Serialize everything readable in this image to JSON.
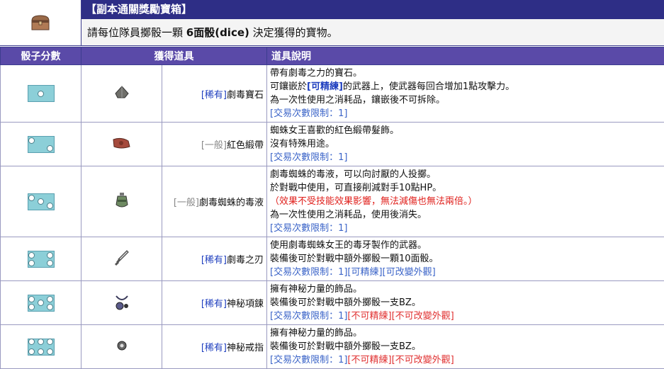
{
  "header": {
    "title": "【副本通關獎勵寶箱】",
    "desc_pre": "請每位隊員擲骰一顆 ",
    "desc_bold": "6面骰(dice)",
    "desc_post": " 決定獲得的寶物。",
    "icon": "treasure-chest-icon"
  },
  "columns": {
    "dice": "骰子分數",
    "item": "獲得道具",
    "desc": "道具說明"
  },
  "rows": [
    {
      "pips": 1,
      "icon": "gem-icon",
      "icon_color": "#6f6f6a",
      "rarity": "[稀有]",
      "rarity_kind": "rare",
      "name": "劇毒寶石",
      "lines": [
        "帶有劇毒之力的寶石。"
      ],
      "line2_pre": "可鑲嵌於",
      "line2_kw": "[可精練]",
      "line2_post": "的武器上，使武器每回合增加1點攻擊力。",
      "line3": "為一次性使用之消耗品，鑲嵌後不可拆除。",
      "trade": "[交易次數限制：1]"
    },
    {
      "pips": 2,
      "icon": "hair-ribbon-icon",
      "icon_color": "#a54a3c",
      "rarity": "[一般]",
      "rarity_kind": "common",
      "name": "紅色緞帶",
      "line1": "蜘蛛女王喜歡的紅色緞帶髮飾。",
      "line2": "沒有特殊用途。",
      "trade": "[交易次數限制：1]"
    },
    {
      "pips": 3,
      "icon": "poison-jar-icon",
      "icon_color": "#6e8a62",
      "rarity": "[一般]",
      "rarity_kind": "common",
      "name": "劇毒蜘蛛的毒液",
      "line1": "劇毒蜘蛛的毒液，可以向討厭的人投擲。",
      "line2": "於對戰中使用，可直接削減對手10點HP。",
      "line3": "（效果不受技能效果影響，無法減傷也無法兩倍。）",
      "line4": "為一次性使用之消耗品，使用後消失。",
      "trade": "[交易次數限制：1]"
    },
    {
      "pips": 4,
      "icon": "dagger-icon",
      "icon_color": "#555",
      "rarity": "[稀有]",
      "rarity_kind": "rare",
      "name": "劇毒之刃",
      "line1": "使用劇毒蜘蛛女王的毒牙製作的武器。",
      "line2": "裝備後可於對戰中額外擲骰一顆10面骰。",
      "trade": "[交易次數限制：1][可精練][可改變外觀]"
    },
    {
      "pips": 5,
      "icon": "necklace-icon",
      "icon_color": "#3a3a5a",
      "rarity": "[稀有]",
      "rarity_kind": "rare",
      "name": "神秘項鍊",
      "line1": "擁有神秘力量的飾品。",
      "line2": "裝備後可於對戰中額外擲骰一支BZ。",
      "trade": "[交易次數限制：1]",
      "neg": "[不可精練][不可改變外觀]"
    },
    {
      "pips": 6,
      "icon": "ring-icon",
      "icon_color": "#444",
      "rarity": "[稀有]",
      "rarity_kind": "rare",
      "name": "神秘戒指",
      "line1": "擁有神秘力量的飾品。",
      "line2": "裝備後可於對戰中額外擲骰一支BZ。",
      "trade": "[交易次數限制：1]",
      "neg": "[不可精練][不可改變外觀]"
    }
  ]
}
